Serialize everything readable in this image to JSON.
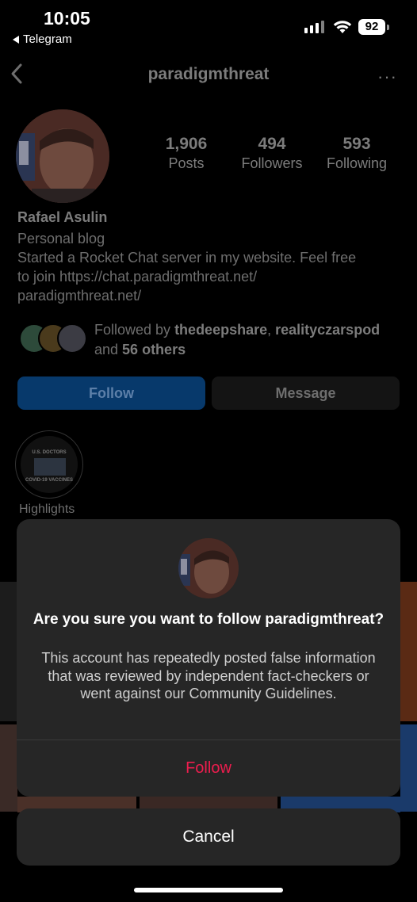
{
  "status_bar": {
    "time": "10:05",
    "back_app": "Telegram",
    "battery": "92"
  },
  "header": {
    "username": "paradigmthreat",
    "more": "···"
  },
  "profile": {
    "stats": [
      {
        "value": "1,906",
        "label": "Posts"
      },
      {
        "value": "494",
        "label": "Followers"
      },
      {
        "value": "593",
        "label": "Following"
      }
    ],
    "name": "Rafael Asulin",
    "category": "Personal blog",
    "bio_line1": "Started a Rocket Chat server in my website. Feel free",
    "bio_line2": "to join https://chat.paradigmthreat.net/",
    "link": "paradigmthreat.net/",
    "followed_by_prefix": "Followed by ",
    "followed_by_user1": "thedeepshare",
    "followed_by_sep": ", ",
    "followed_by_user2": "realityczarspod",
    "followed_by_and": "and ",
    "followed_by_others": "56 others"
  },
  "actions": {
    "follow": "Follow",
    "message": "Message"
  },
  "highlights": {
    "cover_top": "U.S. DOCTORS",
    "cover_bottom": "COVID-19 VACCINES",
    "label": "Highlights"
  },
  "modal": {
    "title": "Are you sure you want to follow paradigmthreat?",
    "body": "This account has repeatedly posted false information that was reviewed by independent fact-checkers or went against our Community Guidelines.",
    "follow_label": "Follow",
    "follow_color": "#ED1D4E"
  },
  "cancel_label": "Cancel",
  "colors": {
    "accent_blue": "#07396B",
    "modal_bg": "#262626",
    "destructive": "#ED1D4E"
  }
}
